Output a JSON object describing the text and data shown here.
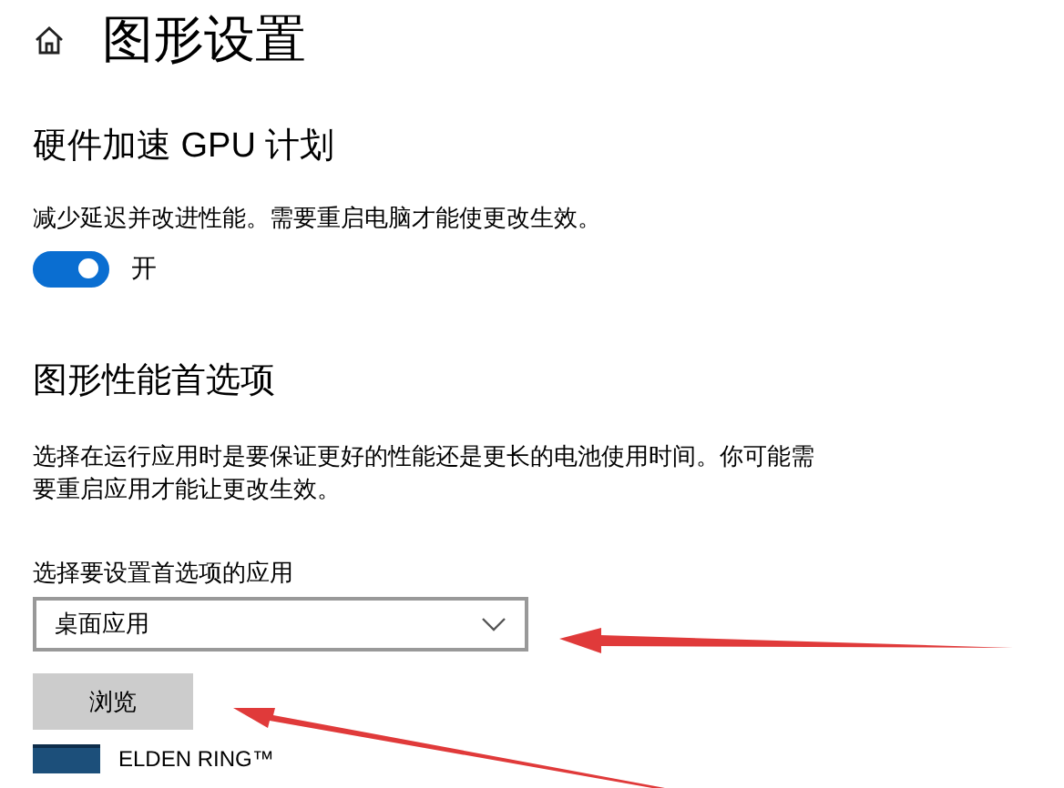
{
  "page": {
    "title": "图形设置"
  },
  "gpu_scheduling": {
    "heading": "硬件加速 GPU 计划",
    "description": "减少延迟并改进性能。需要重启电脑才能使更改生效。",
    "toggle": {
      "on": true,
      "label": "开"
    }
  },
  "preferences": {
    "heading": "图形性能首选项",
    "description": "选择在运行应用时是要保证更好的性能还是更长的电池使用时间。你可能需要重启应用才能让更改生效。",
    "app_type_label": "选择要设置首选项的应用",
    "app_type_value": "桌面应用",
    "browse_button": "浏览"
  },
  "apps": [
    {
      "name": "ELDEN RING™"
    }
  ]
}
